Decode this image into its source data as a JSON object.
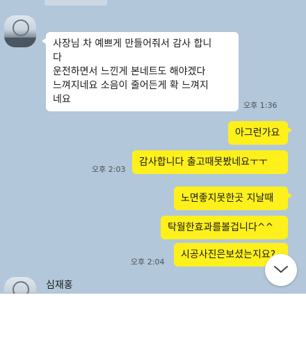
{
  "messages": {
    "m1": {
      "lines": [
        "사장님 차 예쁘게 만들어줘서 감사 합니",
        "다",
        "운전하면서 느낀게 본네트도 해야겠다",
        "느껴지네요 소음이 줄어든게 확 느껴지",
        "네요"
      ],
      "time": "오후 1:36"
    },
    "m2": {
      "text": "아그런가요"
    },
    "m3": {
      "text": "감사합니다 출고때못봤네요ㅜㅜ",
      "time": "오후 2:03"
    },
    "m4": {
      "text": "노면좋지못한곳 지날때"
    },
    "m5": {
      "text": "탁월한효과를볼겁니다^^"
    },
    "m6": {
      "text": "시공사진은보셨는지요?",
      "time": "오후 2:04"
    }
  },
  "sender": {
    "name": "심재홍"
  },
  "icons": {
    "scroll_down": "chevron-down-icon",
    "avatar": "profile-avatar"
  },
  "colors": {
    "background": "#b2c7d9",
    "my_bubble": "#fef01b",
    "their_bubble": "#ffffff"
  }
}
